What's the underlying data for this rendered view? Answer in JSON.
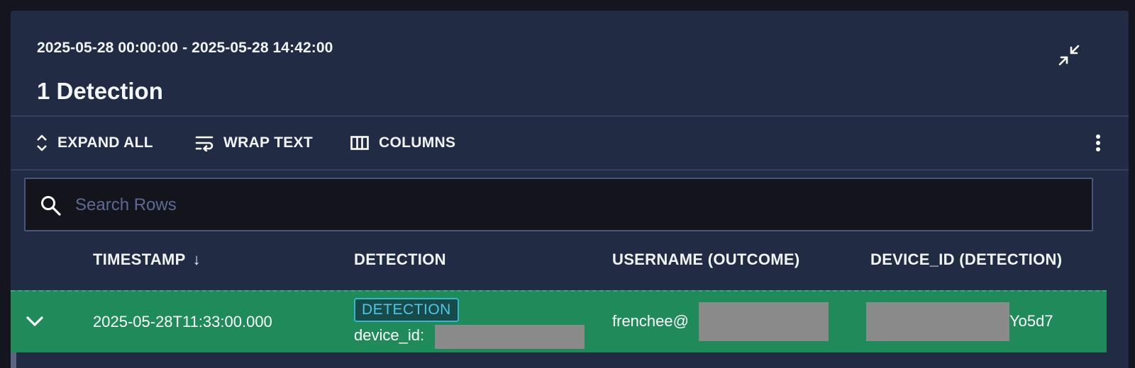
{
  "header": {
    "date_range": "2025-05-28 00:00:00 - 2025-05-28 14:42:00",
    "title": "1 Detection",
    "collapse_icon": "collapse-arrows-icon"
  },
  "toolbar": {
    "expand_all": "EXPAND ALL",
    "wrap_text": "WRAP TEXT",
    "columns": "COLUMNS",
    "more_icon": "more-vertical-icon"
  },
  "search": {
    "placeholder": "Search Rows",
    "value": ""
  },
  "table": {
    "columns": [
      {
        "label": "TIMESTAMP",
        "sort": "↓"
      },
      {
        "label": "DETECTION"
      },
      {
        "label": "USERNAME (OUTCOME)"
      },
      {
        "label": "DEVICE_ID (DETECTION)"
      }
    ],
    "rows": [
      {
        "timestamp": "2025-05-28T11:33:00.000",
        "detection_tag": "DETECTION",
        "detection_field": "device_id:",
        "username_prefix": "frenchee@",
        "device_id_suffix": "Yo5d7"
      }
    ]
  },
  "colors": {
    "panel_bg": "#212b43",
    "row_highlight": "#1f8b5b",
    "tag_border": "#39b4d0",
    "redaction": "#8a8a8a"
  }
}
